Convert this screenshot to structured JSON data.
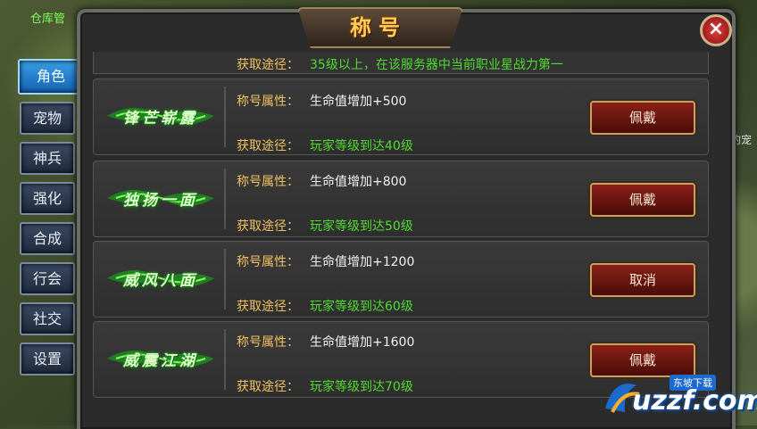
{
  "background": {
    "top_left_text": "仓库管",
    "right_edge_text": "的宠"
  },
  "panel": {
    "title": "称号",
    "close_icon": "close-icon"
  },
  "sidebar": {
    "items": [
      {
        "label": "角色",
        "active": true
      },
      {
        "label": "宠物"
      },
      {
        "label": "神兵"
      },
      {
        "label": "强化"
      },
      {
        "label": "合成"
      },
      {
        "label": "行会"
      },
      {
        "label": "社交"
      },
      {
        "label": "设置"
      }
    ]
  },
  "partial_row": {
    "source_label": "获取途径：",
    "source_value": "35级以上，在该服务器中当前职业星战力第一"
  },
  "titles": [
    {
      "name": "锋芒崭露",
      "attr_label": "称号属性：",
      "attr_value": "生命值增加+500",
      "source_label": "获取途径：",
      "source_value": "玩家等级到达40级",
      "button": "佩戴"
    },
    {
      "name": "独扬一面",
      "attr_label": "称号属性：",
      "attr_value": "生命值增加+800",
      "source_label": "获取途径：",
      "source_value": "玩家等级到达50级",
      "button": "佩戴"
    },
    {
      "name": "威风八面",
      "attr_label": "称号属性：",
      "attr_value": "生命值增加+1200",
      "source_label": "获取途径：",
      "source_value": "玩家等级到达60级",
      "button": "取消"
    },
    {
      "name": "威震江湖",
      "attr_label": "称号属性：",
      "attr_value": "生命值增加+1600",
      "source_label": "获取途径：",
      "source_value": "玩家等级到达70级",
      "button": "佩戴"
    }
  ],
  "watermark": {
    "brand": "uzzf.com",
    "tag": "东坡下载"
  },
  "colors": {
    "label_gold": "#f0c060",
    "value_green": "#4fdc2f",
    "accent_blue": "#1461b0"
  }
}
